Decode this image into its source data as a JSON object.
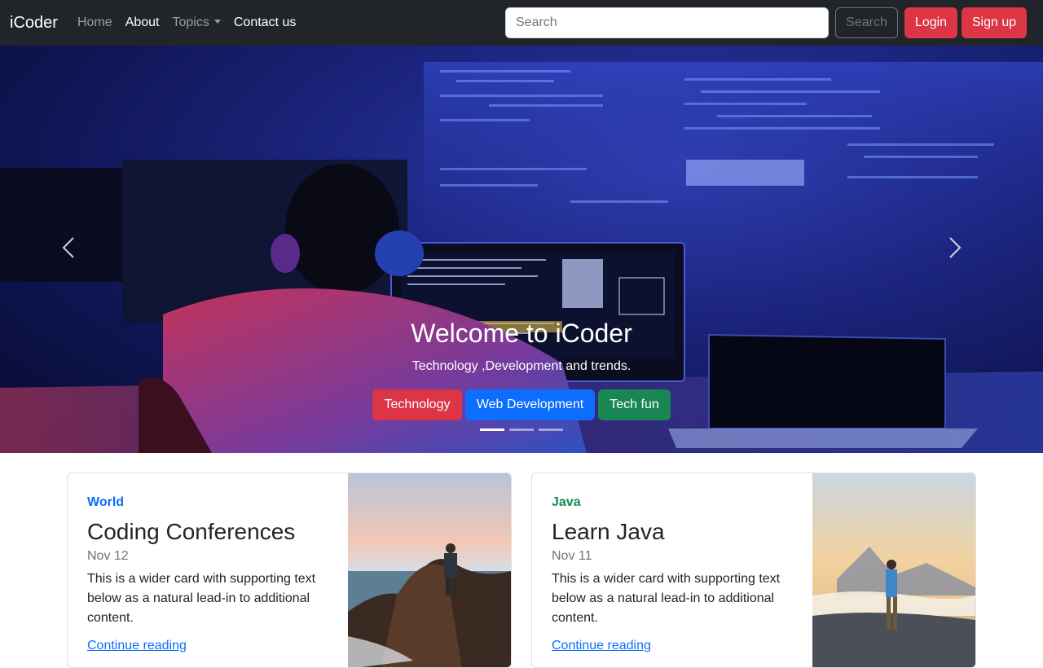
{
  "navbar": {
    "brand": "iCoder",
    "links": [
      {
        "label": "Home"
      },
      {
        "label": "About"
      },
      {
        "label": "Topics"
      },
      {
        "label": "Contact us"
      }
    ],
    "search": {
      "placeholder": "Search",
      "button_label": "Search"
    },
    "login_label": "Login",
    "signup_label": "Sign up"
  },
  "hero": {
    "title": "Welcome to iCoder",
    "subtitle": "Technology ,Development and trends.",
    "buttons": [
      {
        "label": "Technology",
        "color": "#dc3545"
      },
      {
        "label": "Web Development",
        "color": "#0d6efd"
      },
      {
        "label": "Tech fun",
        "color": "#198754"
      }
    ],
    "slide_count": 3,
    "active_slide": 1
  },
  "cards": [
    {
      "category": "World",
      "category_color": "#0d6efd",
      "title": "Coding Conferences",
      "date": "Nov 12",
      "text": "This is a wider card with supporting text below as a natural lead-in to additional content.",
      "link": "Continue reading"
    },
    {
      "category": "Java",
      "category_color": "#198754",
      "title": "Learn Java",
      "date": "Nov 11",
      "text": "This is a wider card with supporting text below as a natural lead-in to additional content.",
      "link": "Continue reading"
    }
  ],
  "colors": {
    "navbar_bg": "#212529",
    "danger": "#dc3545",
    "primary": "#0d6efd",
    "success": "#198754"
  }
}
